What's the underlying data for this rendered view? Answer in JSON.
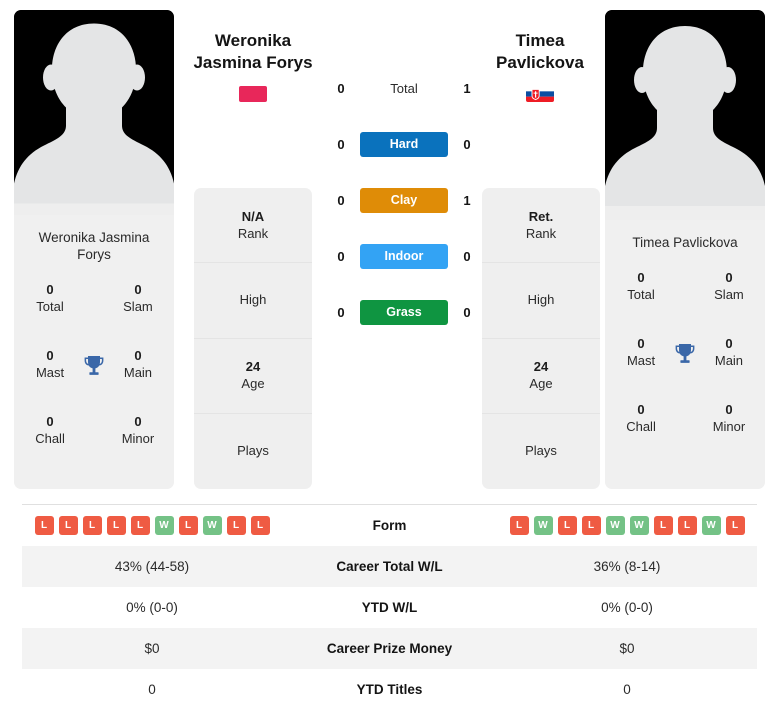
{
  "players": {
    "left": {
      "name": "Weronika Jasmina Forys",
      "name_line1": "Weronika",
      "name_line2": "Jasmina Forys",
      "card_name": "Weronika Jasmina Forys",
      "flag": "poland-flag",
      "flag_colors": [
        "#ffffff",
        "#e8275a"
      ],
      "rank": "N/A",
      "rank_label": "Rank",
      "high_label": "High",
      "high_value": "",
      "age": "24",
      "age_label": "Age",
      "plays_label": "Plays",
      "plays_value": "",
      "titles": [
        {
          "value": "0",
          "label": "Total"
        },
        {
          "value": "0",
          "label": "Slam"
        },
        {
          "value": "0",
          "label": "Mast"
        },
        {
          "value": "0",
          "label": "Main"
        },
        {
          "value": "0",
          "label": "Chall"
        },
        {
          "value": "0",
          "label": "Minor"
        }
      ],
      "form": [
        "L",
        "L",
        "L",
        "L",
        "L",
        "W",
        "L",
        "W",
        "L",
        "L"
      ],
      "career_total_wl": "43% (44-58)",
      "ytd_wl": "0% (0-0)",
      "career_prize_money": "$0",
      "ytd_titles": "0"
    },
    "right": {
      "name": "Timea Pavlickova",
      "name_line1": "Timea",
      "name_line2": "Pavlickova",
      "card_name": "Timea Pavlickova",
      "flag": "slovakia-flag",
      "flag_colors": [
        "#ffffff",
        "#0b4ea2",
        "#ee1c25"
      ],
      "rank": "Ret.",
      "rank_label": "Rank",
      "high_label": "High",
      "high_value": "",
      "age": "24",
      "age_label": "Age",
      "plays_label": "Plays",
      "plays_value": "",
      "titles": [
        {
          "value": "0",
          "label": "Total"
        },
        {
          "value": "0",
          "label": "Slam"
        },
        {
          "value": "0",
          "label": "Mast"
        },
        {
          "value": "0",
          "label": "Main"
        },
        {
          "value": "0",
          "label": "Chall"
        },
        {
          "value": "0",
          "label": "Minor"
        }
      ],
      "form": [
        "L",
        "W",
        "L",
        "L",
        "W",
        "W",
        "L",
        "L",
        "W",
        "L"
      ],
      "career_total_wl": "36% (8-14)",
      "ytd_wl": "0% (0-0)",
      "career_prize_money": "$0",
      "ytd_titles": "0"
    }
  },
  "surfaces": [
    {
      "label": "Total",
      "left": "0",
      "right": "1",
      "color": "none"
    },
    {
      "label": "Hard",
      "left": "0",
      "right": "0",
      "color": "#0a72bd"
    },
    {
      "label": "Clay",
      "left": "0",
      "right": "1",
      "color": "#df8c07"
    },
    {
      "label": "Indoor",
      "left": "0",
      "right": "0",
      "color": "#33a3f4"
    },
    {
      "label": "Grass",
      "left": "0",
      "right": "0",
      "color": "#0f9541"
    }
  ],
  "table": {
    "rows": [
      {
        "key": "form",
        "label": "Form"
      },
      {
        "key": "career",
        "label": "Career Total W/L"
      },
      {
        "key": "ytdwl",
        "label": "YTD W/L"
      },
      {
        "key": "prize",
        "label": "Career Prize Money"
      },
      {
        "key": "titles",
        "label": "YTD Titles"
      }
    ]
  },
  "icons": {
    "trophy": "trophy-icon",
    "avatar": "avatar-silhouette-icon"
  },
  "colors": {
    "win_badge": "#74c286",
    "loss_badge": "#ef5b43",
    "trophy": "#3a67a8",
    "card_bg": "#efefef"
  }
}
